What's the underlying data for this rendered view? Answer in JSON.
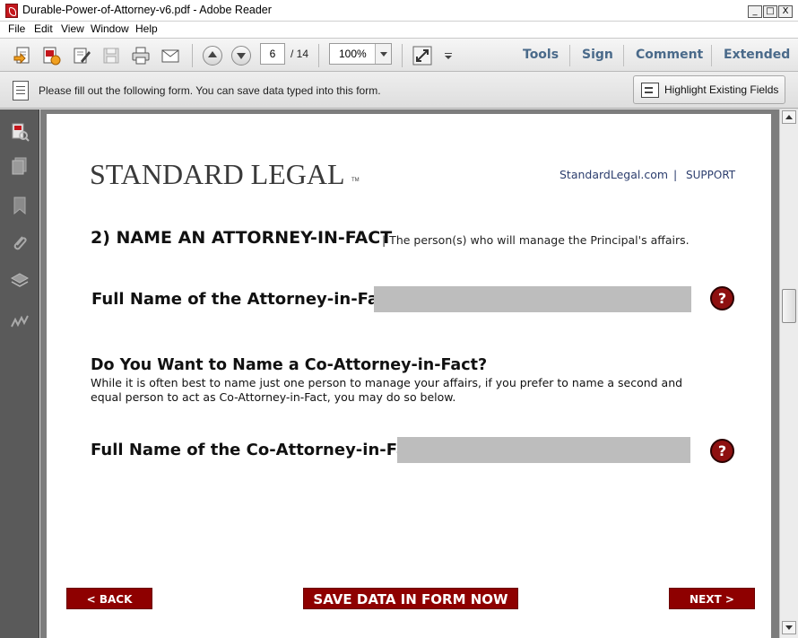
{
  "window": {
    "title": "Durable-Power-of-Attorney-v6.pdf - Adobe Reader",
    "minimize": "_",
    "maximize": "□",
    "close": "X"
  },
  "menu": [
    "File",
    "Edit",
    "View",
    "Window",
    "Help"
  ],
  "toolbar": {
    "page_current": "6",
    "page_total": "/ 14",
    "zoom": "100%",
    "links": [
      "Tools",
      "Sign",
      "Comment",
      "Extended"
    ]
  },
  "infobar": {
    "message": "Please fill out the following form. You can save data typed into this form.",
    "highlight_label": "Highlight Existing Fields"
  },
  "page": {
    "logo_text": "STANDARD LEGAL",
    "logo_tm": "TM",
    "site_link": "StandardLegal.com",
    "link_separator": "|",
    "support_link": "SUPPORT",
    "section_title": "2) NAME AN ATTORNEY-IN-FACT",
    "section_subtitle": "| The person(s) who will manage the Principal's affairs.",
    "attorney_label": "Full Name of the Attorney-in-Fact:",
    "attorney_value": "",
    "co_title": "Do You Want to Name a Co-Attorney-in-Fact?",
    "co_description": "While it is often best to name just one person to manage your affairs, if you prefer to name a second and equal person to act as Co-Attorney-in-Fact, you may do so below.",
    "co_attorney_label": "Full Name of the Co-Attorney-in-Fact:",
    "co_attorney_value": "",
    "help_glyph": "?",
    "back_label": "< BACK",
    "save_label": "SAVE DATA IN FORM NOW",
    "next_label": "NEXT >"
  },
  "colors": {
    "accent_red": "#8e0000",
    "field_gray": "#bdbdbd",
    "link_blue": "#2c3e6e"
  }
}
